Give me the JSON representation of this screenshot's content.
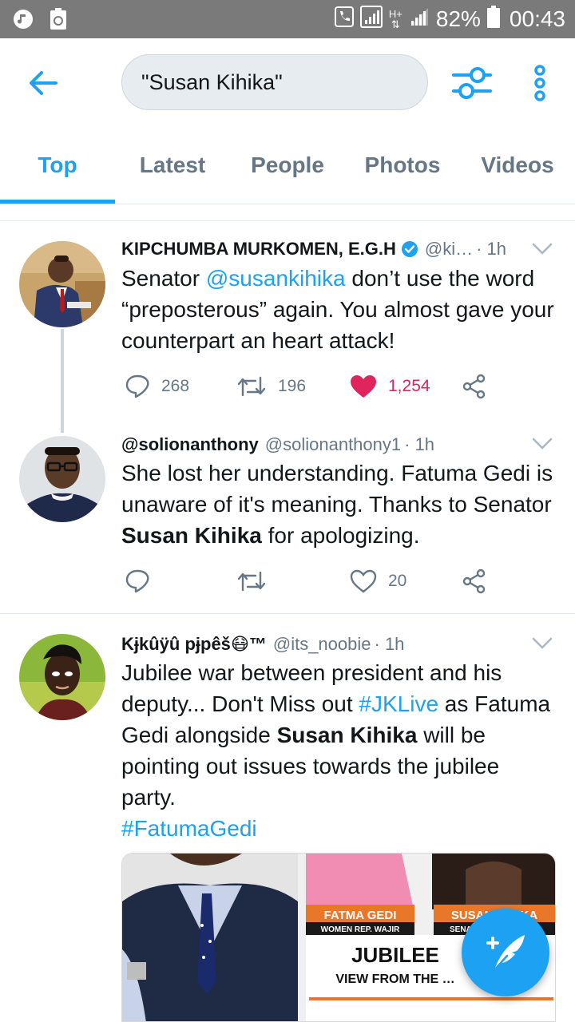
{
  "status_bar": {
    "battery_pct": "82%",
    "time": "00:43",
    "network": "H+"
  },
  "search": {
    "query": "\"Susan Kihika\""
  },
  "tabs": [
    {
      "label": "Top",
      "active": true
    },
    {
      "label": "Latest",
      "active": false
    },
    {
      "label": "People",
      "active": false
    },
    {
      "label": "Photos",
      "active": false
    },
    {
      "label": "Videos",
      "active": false
    }
  ],
  "tweets": [
    {
      "name": "KIPCHUMBA MURKOMEN, E.G.H",
      "handle": "@ki…",
      "time": "· 1h",
      "verified": true,
      "body": {
        "t1": "Senator ",
        "mention": "@susankihika",
        "t2": " don’t use the word  “preposterous” again. You almost gave your counterpart an heart attack!"
      },
      "replies": "268",
      "retweets": "196",
      "likes": "1,254",
      "liked": true
    },
    {
      "name": "@solionanthony",
      "handle": "@solionanthony1",
      "time": "· 1h",
      "body": {
        "t1": "She lost her understanding. Fatuma Gedi is unaware of it's meaning. Thanks to Senator ",
        "bold": "Susan Kihika",
        "t2": " for apologizing."
      },
      "replies": "",
      "retweets": "",
      "likes": "20",
      "liked": false
    },
    {
      "name": "Kɉkûÿû pɉpêš😷™",
      "handle": "@its_noobie",
      "time": "· 1h",
      "body": {
        "t1": "Jubilee war between president and his deputy... Don't Miss out ",
        "tag1": "#JKLive",
        "t2": " as Fatuma Gedi alongside ",
        "bold": "Susan Kihika",
        "t3": " will be pointing out issues towards  the jubilee party.",
        "tag2": "#FatumaGedi"
      }
    }
  ],
  "media": {
    "label1": "FATMA GEDI",
    "sub1": "WOMEN REP. WAJIR",
    "label2": "SUSAN KIHIKA",
    "sub2": "SENA…",
    "headline": "JUBILEE",
    "subheadline": "VIEW FROM THE …"
  },
  "colors": {
    "accent": "#1da1f2",
    "like": "#e0245e",
    "muted": "#657786"
  }
}
